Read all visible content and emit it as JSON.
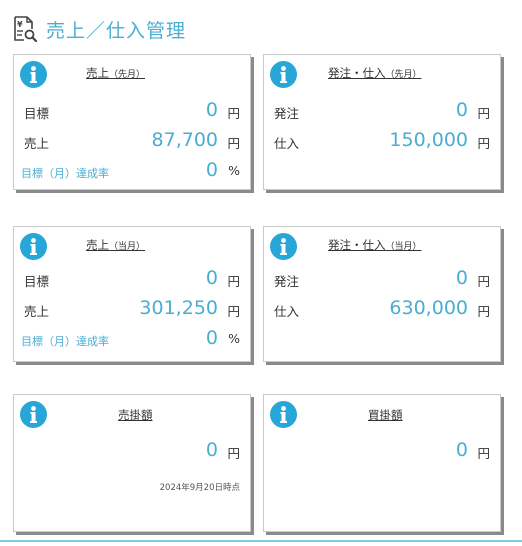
{
  "header": {
    "title": "売上／仕入管理",
    "icon": "yen-document-search-icon"
  },
  "colors": {
    "accent": "#4aaed3",
    "info": "#27a6d8"
  },
  "cards": {
    "sales_prev": {
      "title": "売上",
      "title_suffix": "（先月）",
      "rows": [
        {
          "label": "目標",
          "value": "0",
          "unit": "円"
        },
        {
          "label": "売上",
          "value": "87,700",
          "unit": "円"
        },
        {
          "label": "目標（月）達成率",
          "value": "0",
          "unit": "%"
        }
      ]
    },
    "orders_prev": {
      "title": "発注・仕入",
      "title_suffix": "（先月）",
      "rows": [
        {
          "label": "発注",
          "value": "0",
          "unit": "円"
        },
        {
          "label": "仕入",
          "value": "150,000",
          "unit": "円"
        }
      ]
    },
    "sales_curr": {
      "title": "売上",
      "title_suffix": "（当月）",
      "rows": [
        {
          "label": "目標",
          "value": "0",
          "unit": "円"
        },
        {
          "label": "売上",
          "value": "301,250",
          "unit": "円"
        },
        {
          "label": "目標（月）達成率",
          "value": "0",
          "unit": "%"
        }
      ]
    },
    "orders_curr": {
      "title": "発注・仕入",
      "title_suffix": "（当月）",
      "rows": [
        {
          "label": "発注",
          "value": "0",
          "unit": "円"
        },
        {
          "label": "仕入",
          "value": "630,000",
          "unit": "円"
        }
      ]
    },
    "receivables": {
      "title": "売掛額",
      "value": "0",
      "unit": "円",
      "timestamp": "2024年9月20日時点"
    },
    "payables": {
      "title": "買掛額",
      "value": "0",
      "unit": "円"
    }
  }
}
